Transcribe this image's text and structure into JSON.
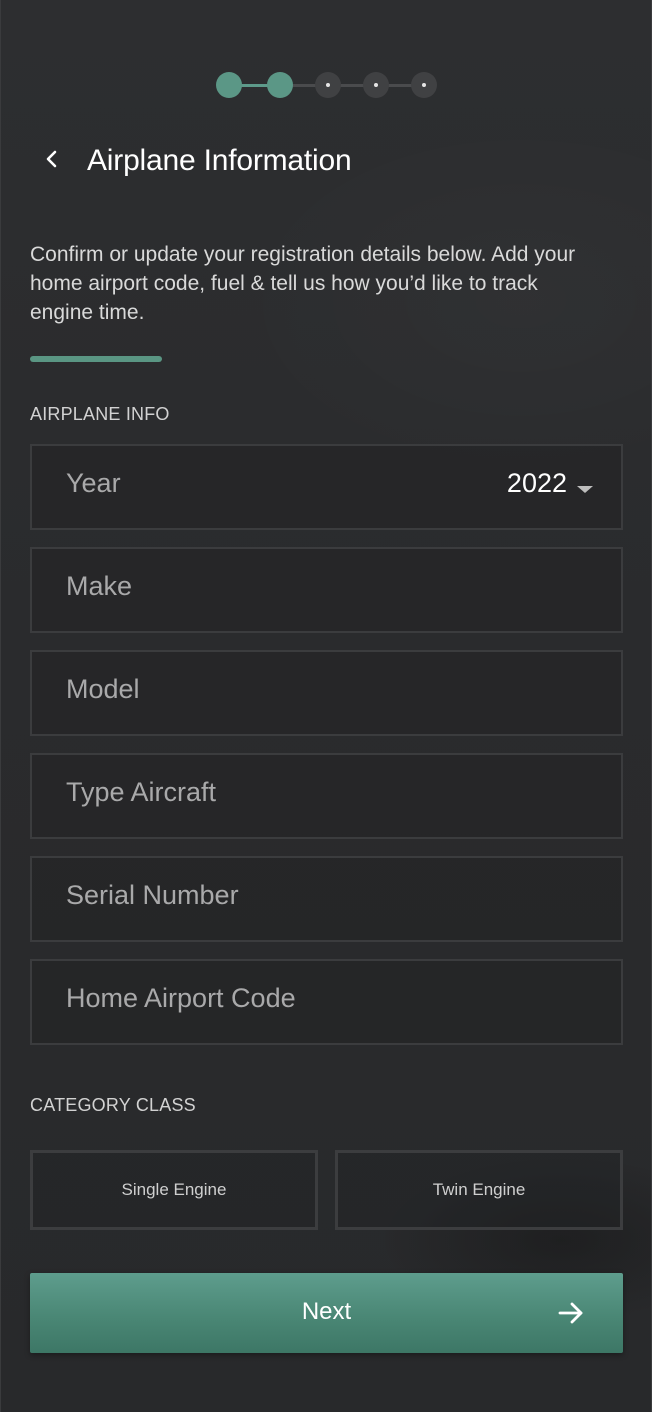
{
  "stepper": {
    "current_step": 2,
    "total_steps": 5,
    "accent_color": "#5b9786"
  },
  "header": {
    "title": "Airplane Information"
  },
  "description": "Confirm or update your registration details below. Add your home airport code, fuel & tell us how you’d like to track engine time.",
  "sections": {
    "airplane_info": "AIRPLANE INFO",
    "category_class": "CATEGORY CLASS"
  },
  "fields": {
    "year": {
      "label": "Year",
      "value": "2022"
    },
    "make": {
      "label": "Make"
    },
    "model": {
      "label": "Model"
    },
    "type_aircraft": {
      "label": "Type Aircraft"
    },
    "serial_number": {
      "label": "Serial Number"
    },
    "home_airport": {
      "label": "Home Airport Code"
    }
  },
  "category_options": {
    "single": "Single Engine",
    "twin": "Twin Engine"
  },
  "next_button": {
    "label": "Next"
  },
  "icons": {
    "back": "chevron-left-icon",
    "dropdown": "caret-down-icon",
    "next": "arrow-right-icon"
  }
}
